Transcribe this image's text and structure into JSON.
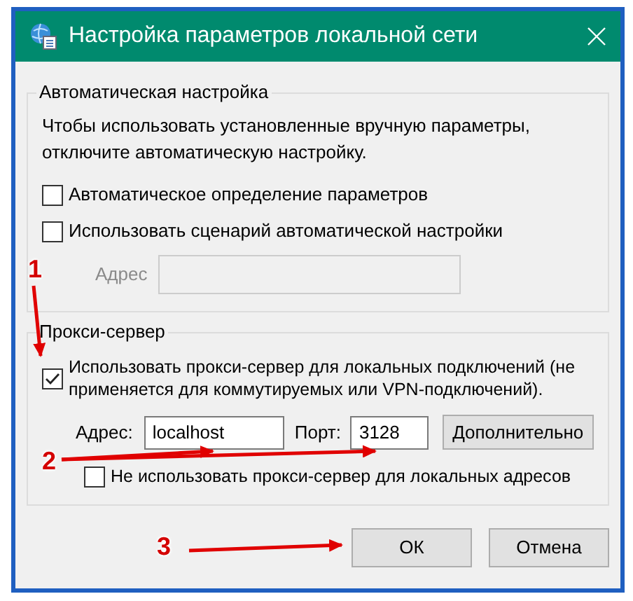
{
  "window": {
    "title": "Настройка параметров локальной сети"
  },
  "auto_config": {
    "legend": "Автоматическая настройка",
    "note": "Чтобы использовать установленные вручную параметры,\nотключите автоматическую настройку.",
    "options": [
      {
        "label": "Автоматическое определение параметров",
        "checked": false
      },
      {
        "label": "Использовать сценарий автоматической настройки",
        "checked": false
      }
    ],
    "address": {
      "label": "Адрес",
      "disabled": true
    }
  },
  "proxy": {
    "legend": "Прокси-сервер",
    "use_proxy": {
      "label": "Использовать прокси-сервер для локальных подключений (не применяется для коммутируемых или VPN-подключений).",
      "checked": true
    },
    "address": {
      "label": "Адрес:",
      "value": "localhost"
    },
    "port": {
      "label": "Порт:",
      "value": "3128"
    },
    "advanced_button": "Дополнительно",
    "bypass_local": {
      "label": "Не использовать прокси-сервер для локальных адресов",
      "checked": false
    }
  },
  "buttons": [
    "ОК",
    "Отмена"
  ],
  "annotations": [
    {
      "number": "1"
    },
    {
      "number": "2"
    },
    {
      "number": "3"
    }
  ]
}
